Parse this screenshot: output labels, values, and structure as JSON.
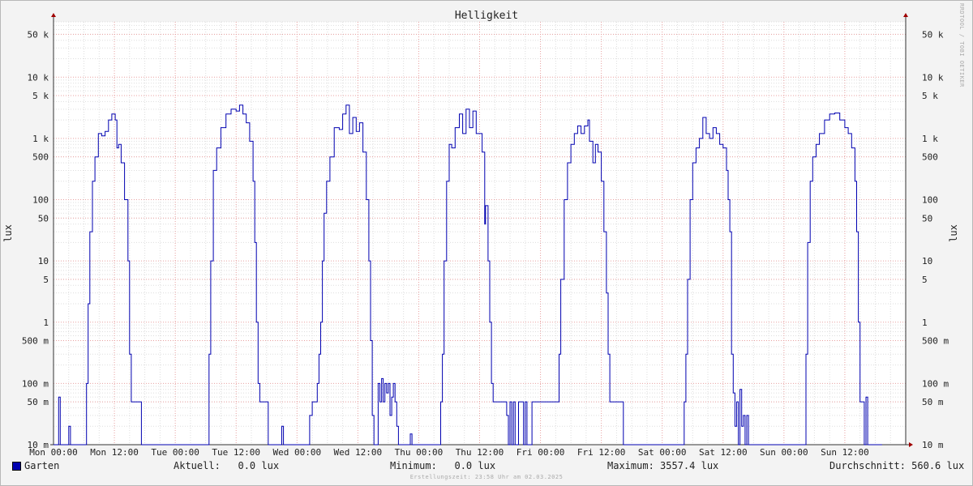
{
  "chart_data": {
    "type": "line",
    "title": "Helligkeit",
    "ylabel": "lux",
    "yscale": "log",
    "ylim": [
      0.01,
      80000
    ],
    "y_ticks": [
      {
        "value": 0.01,
        "label": "10 m"
      },
      {
        "value": 0.05,
        "label": "50 m"
      },
      {
        "value": 0.1,
        "label": "100 m"
      },
      {
        "value": 0.5,
        "label": "500 m"
      },
      {
        "value": 1,
        "label": "1"
      },
      {
        "value": 5,
        "label": "5"
      },
      {
        "value": 10,
        "label": "10"
      },
      {
        "value": 50,
        "label": "50"
      },
      {
        "value": 100,
        "label": "100"
      },
      {
        "value": 500,
        "label": "500"
      },
      {
        "value": 1000,
        "label": "1 k"
      },
      {
        "value": 5000,
        "label": "5 k"
      },
      {
        "value": 10000,
        "label": "10 k"
      },
      {
        "value": 50000,
        "label": "50 k"
      }
    ],
    "x_ticks": [
      "Mon 00:00",
      "Mon 12:00",
      "Tue 00:00",
      "Tue 12:00",
      "Wed 00:00",
      "Wed 12:00",
      "Thu 00:00",
      "Thu 12:00",
      "Fri 00:00",
      "Fri 12:00",
      "Sat 00:00",
      "Sat 12:00",
      "Sun 00:00",
      "Sun 12:00"
    ],
    "grid": true,
    "series": [
      {
        "name": "Garten",
        "color": "#0000b0",
        "points": [
          [
            "Mon 00:00",
            0.01
          ],
          [
            "Mon 01:00",
            0.06
          ],
          [
            "Mon 01:20",
            0.01
          ],
          [
            "Mon 02:30",
            0.01
          ],
          [
            "Mon 03:00",
            0.02
          ],
          [
            "Mon 03:20",
            0.01
          ],
          [
            "Mon 06:00",
            0.01
          ],
          [
            "Mon 06:30",
            0.1
          ],
          [
            "Mon 06:50",
            2
          ],
          [
            "Mon 07:10",
            30
          ],
          [
            "Mon 07:40",
            200
          ],
          [
            "Mon 08:10",
            500
          ],
          [
            "Mon 08:50",
            1200
          ],
          [
            "Mon 09:30",
            1100
          ],
          [
            "Mon 10:10",
            1300
          ],
          [
            "Mon 10:50",
            2000
          ],
          [
            "Mon 11:30",
            2500
          ],
          [
            "Mon 12:10",
            2000
          ],
          [
            "Mon 12:30",
            700
          ],
          [
            "Mon 12:50",
            800
          ],
          [
            "Mon 13:20",
            400
          ],
          [
            "Mon 14:00",
            100
          ],
          [
            "Mon 14:40",
            10
          ],
          [
            "Mon 15:00",
            0.3
          ],
          [
            "Mon 15:20",
            0.05
          ],
          [
            "Mon 16:00",
            0.05
          ],
          [
            "Mon 17:00",
            0.05
          ],
          [
            "Mon 17:20",
            0.01
          ],
          [
            "Tue 06:20",
            0.01
          ],
          [
            "Tue 06:40",
            0.3
          ],
          [
            "Tue 07:00",
            10
          ],
          [
            "Tue 07:30",
            300
          ],
          [
            "Tue 08:10",
            700
          ],
          [
            "Tue 09:00",
            1500
          ],
          [
            "Tue 10:00",
            2500
          ],
          [
            "Tue 11:00",
            3000
          ],
          [
            "Tue 12:00",
            2800
          ],
          [
            "Tue 12:40",
            3500
          ],
          [
            "Tue 13:20",
            2500
          ],
          [
            "Tue 14:00",
            1800
          ],
          [
            "Tue 14:40",
            900
          ],
          [
            "Tue 15:20",
            200
          ],
          [
            "Tue 15:40",
            20
          ],
          [
            "Tue 16:00",
            1
          ],
          [
            "Tue 16:20",
            0.1
          ],
          [
            "Tue 16:40",
            0.05
          ],
          [
            "Tue 18:00",
            0.05
          ],
          [
            "Tue 18:20",
            0.01
          ],
          [
            "Tue 20:00",
            0.01
          ],
          [
            "Tue 21:00",
            0.02
          ],
          [
            "Tue 21:20",
            0.01
          ],
          [
            "Wed 02:00",
            0.01
          ],
          [
            "Wed 02:30",
            0.03
          ],
          [
            "Wed 03:00",
            0.05
          ],
          [
            "Wed 03:30",
            0.05
          ],
          [
            "Wed 04:00",
            0.1
          ],
          [
            "Wed 04:20",
            0.3
          ],
          [
            "Wed 04:40",
            1
          ],
          [
            "Wed 05:00",
            10
          ],
          [
            "Wed 05:20",
            60
          ],
          [
            "Wed 05:50",
            200
          ],
          [
            "Wed 06:30",
            500
          ],
          [
            "Wed 07:20",
            1500
          ],
          [
            "Wed 08:20",
            1400
          ],
          [
            "Wed 09:00",
            2500
          ],
          [
            "Wed 09:40",
            3500
          ],
          [
            "Wed 10:20",
            1200
          ],
          [
            "Wed 11:00",
            2200
          ],
          [
            "Wed 11:40",
            1300
          ],
          [
            "Wed 12:20",
            1800
          ],
          [
            "Wed 13:00",
            600
          ],
          [
            "Wed 13:40",
            100
          ],
          [
            "Wed 14:10",
            10
          ],
          [
            "Wed 14:30",
            0.5
          ],
          [
            "Wed 14:50",
            0.03
          ],
          [
            "Wed 15:10",
            0.01
          ],
          [
            "Wed 16:00",
            0.1
          ],
          [
            "Wed 16:20",
            0.05
          ],
          [
            "Wed 16:40",
            0.12
          ],
          [
            "Wed 17:00",
            0.05
          ],
          [
            "Wed 17:20",
            0.1
          ],
          [
            "Wed 17:40",
            0.07
          ],
          [
            "Wed 18:00",
            0.1
          ],
          [
            "Wed 18:20",
            0.03
          ],
          [
            "Wed 18:40",
            0.06
          ],
          [
            "Wed 19:00",
            0.1
          ],
          [
            "Wed 19:20",
            0.05
          ],
          [
            "Wed 19:40",
            0.02
          ],
          [
            "Wed 20:00",
            0.01
          ],
          [
            "Wed 22:00",
            0.01
          ],
          [
            "Wed 22:20",
            0.015
          ],
          [
            "Wed 22:40",
            0.01
          ],
          [
            "Thu 04:00",
            0.01
          ],
          [
            "Thu 04:20",
            0.05
          ],
          [
            "Thu 04:40",
            0.3
          ],
          [
            "Thu 05:00",
            10
          ],
          [
            "Thu 05:30",
            200
          ],
          [
            "Thu 06:00",
            800
          ],
          [
            "Thu 06:30",
            700
          ],
          [
            "Thu 07:10",
            1500
          ],
          [
            "Thu 08:00",
            2500
          ],
          [
            "Thu 08:40",
            1200
          ],
          [
            "Thu 09:20",
            3000
          ],
          [
            "Thu 10:00",
            1500
          ],
          [
            "Thu 10:40",
            2800
          ],
          [
            "Thu 11:20",
            1200
          ],
          [
            "Thu 12:00",
            1200
          ],
          [
            "Thu 12:30",
            600
          ],
          [
            "Thu 13:00",
            40
          ],
          [
            "Thu 13:10",
            80
          ],
          [
            "Thu 13:40",
            10
          ],
          [
            "Thu 14:00",
            1
          ],
          [
            "Thu 14:20",
            0.1
          ],
          [
            "Thu 14:40",
            0.05
          ],
          [
            "Thu 16:00",
            0.05
          ],
          [
            "Thu 17:00",
            0.05
          ],
          [
            "Thu 17:20",
            0.03
          ],
          [
            "Thu 17:40",
            0.01
          ],
          [
            "Thu 18:00",
            0.05
          ],
          [
            "Thu 18:20",
            0.01
          ],
          [
            "Thu 18:40",
            0.05
          ],
          [
            "Thu 19:00",
            0.01
          ],
          [
            "Thu 19:40",
            0.05
          ],
          [
            "Thu 20:20",
            0.05
          ],
          [
            "Thu 20:40",
            0.01
          ],
          [
            "Thu 21:00",
            0.05
          ],
          [
            "Thu 21:20",
            0.01
          ],
          [
            "Thu 22:00",
            0.01
          ],
          [
            "Thu 22:20",
            0.05
          ],
          [
            "Fri 02:00",
            0.05
          ],
          [
            "Fri 03:00",
            0.05
          ],
          [
            "Fri 03:40",
            0.3
          ],
          [
            "Fri 04:00",
            5
          ],
          [
            "Fri 04:40",
            100
          ],
          [
            "Fri 05:20",
            400
          ],
          [
            "Fri 06:00",
            800
          ],
          [
            "Fri 06:40",
            1200
          ],
          [
            "Fri 07:20",
            1600
          ],
          [
            "Fri 08:00",
            1200
          ],
          [
            "Fri 08:40",
            1600
          ],
          [
            "Fri 09:20",
            2000
          ],
          [
            "Fri 09:40",
            900
          ],
          [
            "Fri 10:20",
            400
          ],
          [
            "Fri 10:50",
            800
          ],
          [
            "Fri 11:20",
            600
          ],
          [
            "Fri 12:00",
            200
          ],
          [
            "Fri 12:30",
            30
          ],
          [
            "Fri 13:00",
            3
          ],
          [
            "Fri 13:20",
            0.3
          ],
          [
            "Fri 13:40",
            0.05
          ],
          [
            "Fri 14:40",
            0.05
          ],
          [
            "Fri 16:00",
            0.05
          ],
          [
            "Fri 16:20",
            0.01
          ],
          [
            "Sat 04:00",
            0.01
          ],
          [
            "Sat 04:20",
            0.05
          ],
          [
            "Sat 04:40",
            0.3
          ],
          [
            "Sat 05:00",
            5
          ],
          [
            "Sat 05:30",
            100
          ],
          [
            "Sat 06:00",
            400
          ],
          [
            "Sat 06:40",
            700
          ],
          [
            "Sat 07:20",
            1000
          ],
          [
            "Sat 08:00",
            2200
          ],
          [
            "Sat 08:40",
            1200
          ],
          [
            "Sat 09:20",
            1000
          ],
          [
            "Sat 10:00",
            1500
          ],
          [
            "Sat 10:40",
            1200
          ],
          [
            "Sat 11:20",
            800
          ],
          [
            "Sat 12:00",
            700
          ],
          [
            "Sat 12:40",
            300
          ],
          [
            "Sat 13:00",
            100
          ],
          [
            "Sat 13:20",
            30
          ],
          [
            "Sat 13:40",
            0.3
          ],
          [
            "Sat 14:00",
            0.07
          ],
          [
            "Sat 14:20",
            0.02
          ],
          [
            "Sat 14:40",
            0.05
          ],
          [
            "Sat 15:00",
            0.01
          ],
          [
            "Sat 15:20",
            0.08
          ],
          [
            "Sat 15:40",
            0.02
          ],
          [
            "Sat 16:00",
            0.03
          ],
          [
            "Sat 16:20",
            0.01
          ],
          [
            "Sat 16:40",
            0.03
          ],
          [
            "Sat 17:00",
            0.01
          ],
          [
            "Sun 04:00",
            0.01
          ],
          [
            "Sun 04:20",
            0.3
          ],
          [
            "Sun 04:40",
            20
          ],
          [
            "Sun 05:10",
            200
          ],
          [
            "Sun 05:40",
            500
          ],
          [
            "Sun 06:20",
            800
          ],
          [
            "Sun 07:00",
            1200
          ],
          [
            "Sun 08:00",
            2000
          ],
          [
            "Sun 09:00",
            2500
          ],
          [
            "Sun 10:00",
            2600
          ],
          [
            "Sun 11:00",
            2000
          ],
          [
            "Sun 12:00",
            1500
          ],
          [
            "Sun 12:40",
            1200
          ],
          [
            "Sun 13:20",
            700
          ],
          [
            "Sun 14:00",
            200
          ],
          [
            "Sun 14:20",
            30
          ],
          [
            "Sun 14:40",
            1
          ],
          [
            "Sun 15:00",
            0.05
          ],
          [
            "Sun 15:30",
            0.05
          ],
          [
            "Sun 15:50",
            0.01
          ],
          [
            "Sun 16:10",
            0.06
          ],
          [
            "Sun 16:30",
            0.01
          ],
          [
            "Sun 19:20",
            0.01
          ]
        ]
      }
    ]
  },
  "legend": {
    "series_name": "Garten",
    "current": "Aktuell:   0.0 lux",
    "minimum": "Minimum:   0.0 lux",
    "maximum": "Maximum: 3557.4 lux",
    "average": "Durchschnitt: 560.6 lux"
  },
  "footer": "Erstellungszeit: 23:58 Uhr am 02.03.2025",
  "sidebar": "RRDTOOL / TOBI OETIKER"
}
